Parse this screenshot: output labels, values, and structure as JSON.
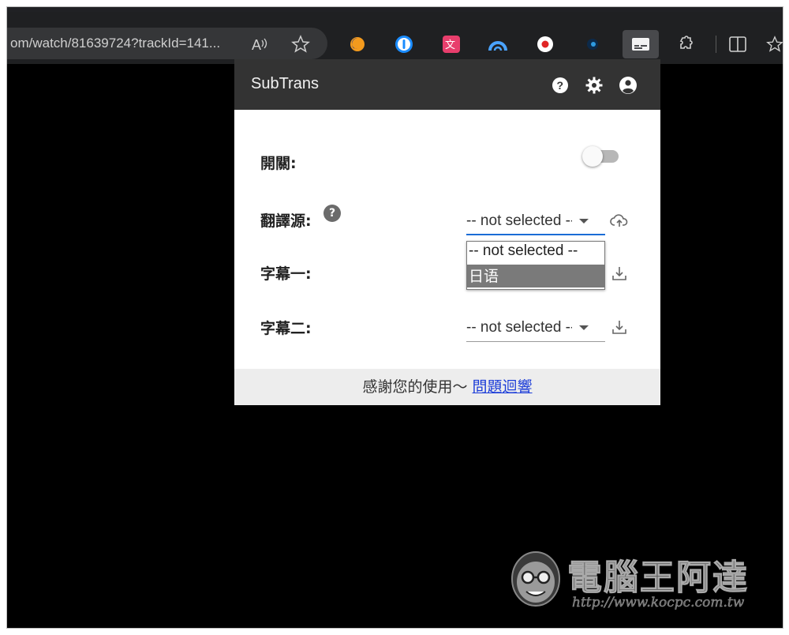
{
  "browser": {
    "url": "om/watch/81639724?trackId=141...",
    "extensions": [
      "read-aloud-icon",
      "favorite-star-icon",
      "ext-orange-icon",
      "ext-1password-icon",
      "ext-translate-icon",
      "ext-arc-icon",
      "ext-record-icon",
      "ext-dark-icon",
      "ext-subtrans-icon",
      "extensions-puzzle-icon",
      "split-screen-icon",
      "favorites-icon"
    ]
  },
  "popup": {
    "title": "SubTrans",
    "header_icons": [
      "help-icon",
      "settings-icon",
      "account-icon"
    ],
    "rows": [
      {
        "label": "開關:"
      },
      {
        "label": "翻譯源:",
        "help": "?",
        "value": "-- not selected --"
      },
      {
        "label": "字幕一:"
      },
      {
        "label": "字幕二:",
        "value": "-- not selected --"
      }
    ],
    "dropdown": {
      "options": [
        "-- not selected --",
        "日语"
      ],
      "highlighted": "日语"
    },
    "footer": {
      "text": "感謝您的使用～ ",
      "link": "問題迴響"
    }
  },
  "watermark": {
    "title": "電腦王阿達",
    "url": "http://www.kocpc.com.tw"
  },
  "colors": {
    "header_bg": "#333333",
    "focus_underline": "#1a6dd6",
    "link": "#1a3bd8",
    "dropdown_highlight": "#7a7a7a"
  }
}
